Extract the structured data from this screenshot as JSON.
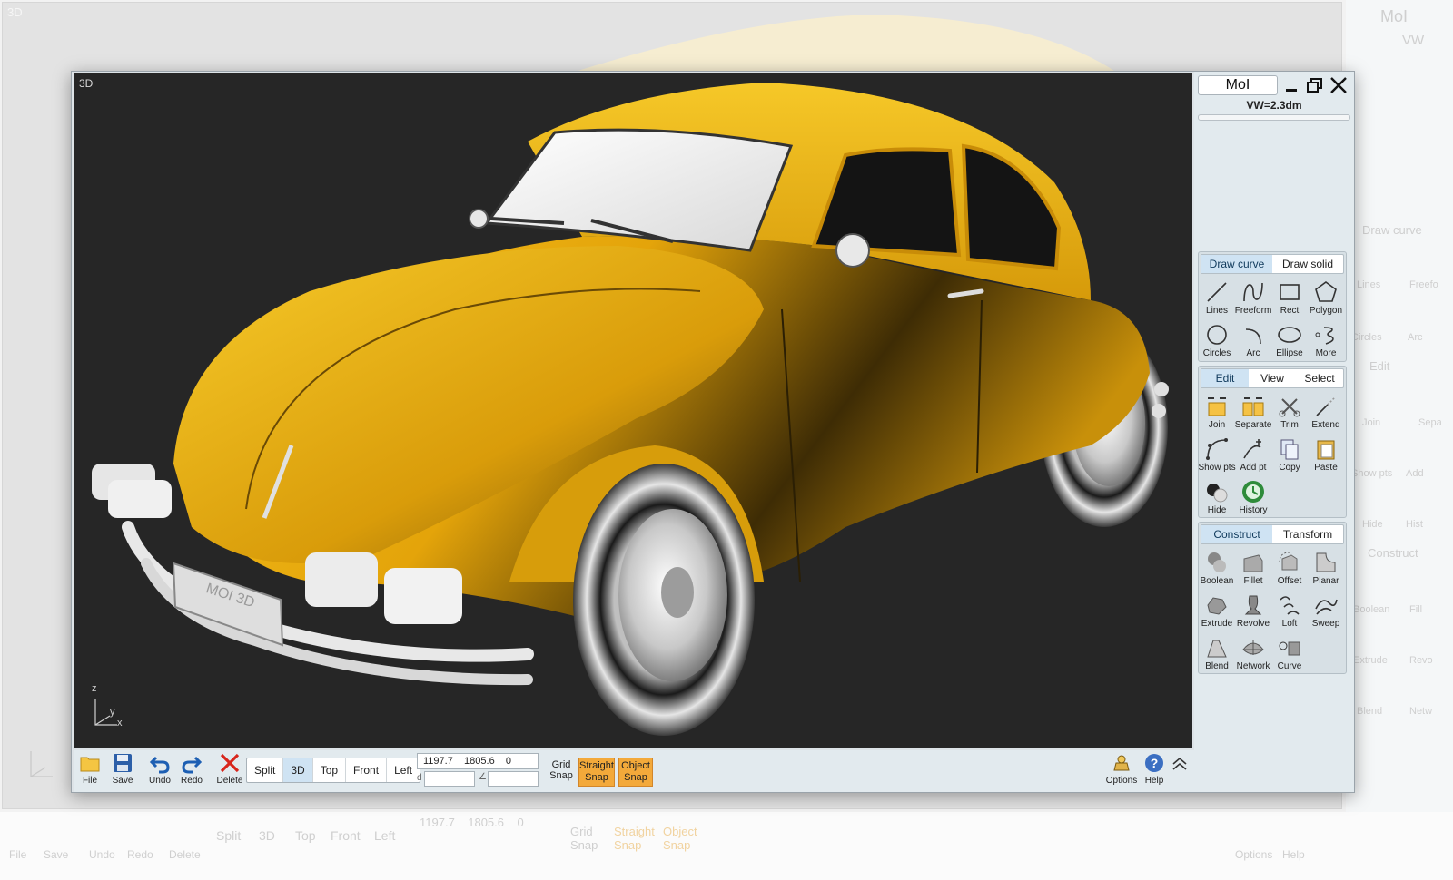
{
  "app": {
    "title": "MoI",
    "subtitle": "VW=2.3dm",
    "viewport_label": "3D"
  },
  "panel": {
    "draw_tabs": [
      "Draw curve",
      "Draw solid"
    ],
    "draw_tools": [
      {
        "label": "Lines",
        "icon": "lines-icon"
      },
      {
        "label": "Freeform",
        "icon": "freeform-icon"
      },
      {
        "label": "Rect",
        "icon": "rect-icon"
      },
      {
        "label": "Polygon",
        "icon": "polygon-icon"
      },
      {
        "label": "Circles",
        "icon": "circle-icon"
      },
      {
        "label": "Arc",
        "icon": "arc-icon"
      },
      {
        "label": "Ellipse",
        "icon": "ellipse-icon"
      },
      {
        "label": "More",
        "icon": "more-icon"
      }
    ],
    "edit_tabs": [
      "Edit",
      "View",
      "Select"
    ],
    "edit_tools": [
      {
        "label": "Join",
        "icon": "join-icon"
      },
      {
        "label": "Separate",
        "icon": "separate-icon"
      },
      {
        "label": "Trim",
        "icon": "trim-icon"
      },
      {
        "label": "Extend",
        "icon": "extend-icon"
      },
      {
        "label": "Show pts",
        "icon": "show-points-icon"
      },
      {
        "label": "Add pt",
        "icon": "add-point-icon"
      },
      {
        "label": "Copy",
        "icon": "copy-icon"
      },
      {
        "label": "Paste",
        "icon": "paste-icon"
      },
      {
        "label": "Hide",
        "icon": "hide-icon"
      },
      {
        "label": "History",
        "icon": "history-icon"
      }
    ],
    "construct_tabs": [
      "Construct",
      "Transform"
    ],
    "construct_tools": [
      {
        "label": "Boolean",
        "icon": "boolean-icon"
      },
      {
        "label": "Fillet",
        "icon": "fillet-icon"
      },
      {
        "label": "Offset",
        "icon": "offset-icon"
      },
      {
        "label": "Planar",
        "icon": "planar-icon"
      },
      {
        "label": "Extrude",
        "icon": "extrude-icon"
      },
      {
        "label": "Revolve",
        "icon": "revolve-icon"
      },
      {
        "label": "Loft",
        "icon": "loft-icon"
      },
      {
        "label": "Sweep",
        "icon": "sweep-icon"
      },
      {
        "label": "Blend",
        "icon": "blend-icon"
      },
      {
        "label": "Network",
        "icon": "network-icon"
      },
      {
        "label": "Curve",
        "icon": "curve-icon"
      }
    ]
  },
  "toolbar": {
    "file": "File",
    "save": "Save",
    "undo": "Undo",
    "redo": "Redo",
    "delete": "Delete",
    "views": [
      "Split",
      "3D",
      "Top",
      "Front",
      "Left"
    ],
    "active_view": "3D",
    "coords": "1197.7    1805.6    0",
    "distance_label": "d",
    "angle_label": "∠",
    "grid_snap": [
      "Grid",
      "Snap"
    ],
    "straight_snap": [
      "Straight",
      "Snap"
    ],
    "object_snap": [
      "Object",
      "Snap"
    ],
    "options": "Options",
    "help": "Help"
  },
  "axis": {
    "z": "z",
    "y": "y",
    "x": "x"
  },
  "background_ghost": {
    "title": "MoI",
    "subtitle": "VW",
    "label_3d": "3D",
    "panel_labels": [
      "Draw curve",
      "Lines",
      "Freefo",
      "Circles",
      "Arc",
      "Edit",
      "Join",
      "Sepa",
      "Show pts",
      "Add",
      "Hide",
      "Hist",
      "Construct",
      "Boolean",
      "Fill",
      "Extrude",
      "Revo",
      "Blend",
      "Netw"
    ],
    "bottom_labels": [
      "File",
      "Save",
      "Undo",
      "Redo",
      "Delete",
      "Split",
      "3D",
      "Top",
      "Front",
      "Left",
      "Grid Snap",
      "Straight Snap",
      "Object Snap",
      "Options",
      "Help"
    ],
    "coords": "1197.7    1805.6    0"
  },
  "colors": {
    "accent_tab": "#cfe3f3",
    "snap_orange": "#f3a93a",
    "car_yellow": "#e8a90c",
    "viewport_bg": "#262626",
    "panel_bg": "#e2eaee"
  }
}
